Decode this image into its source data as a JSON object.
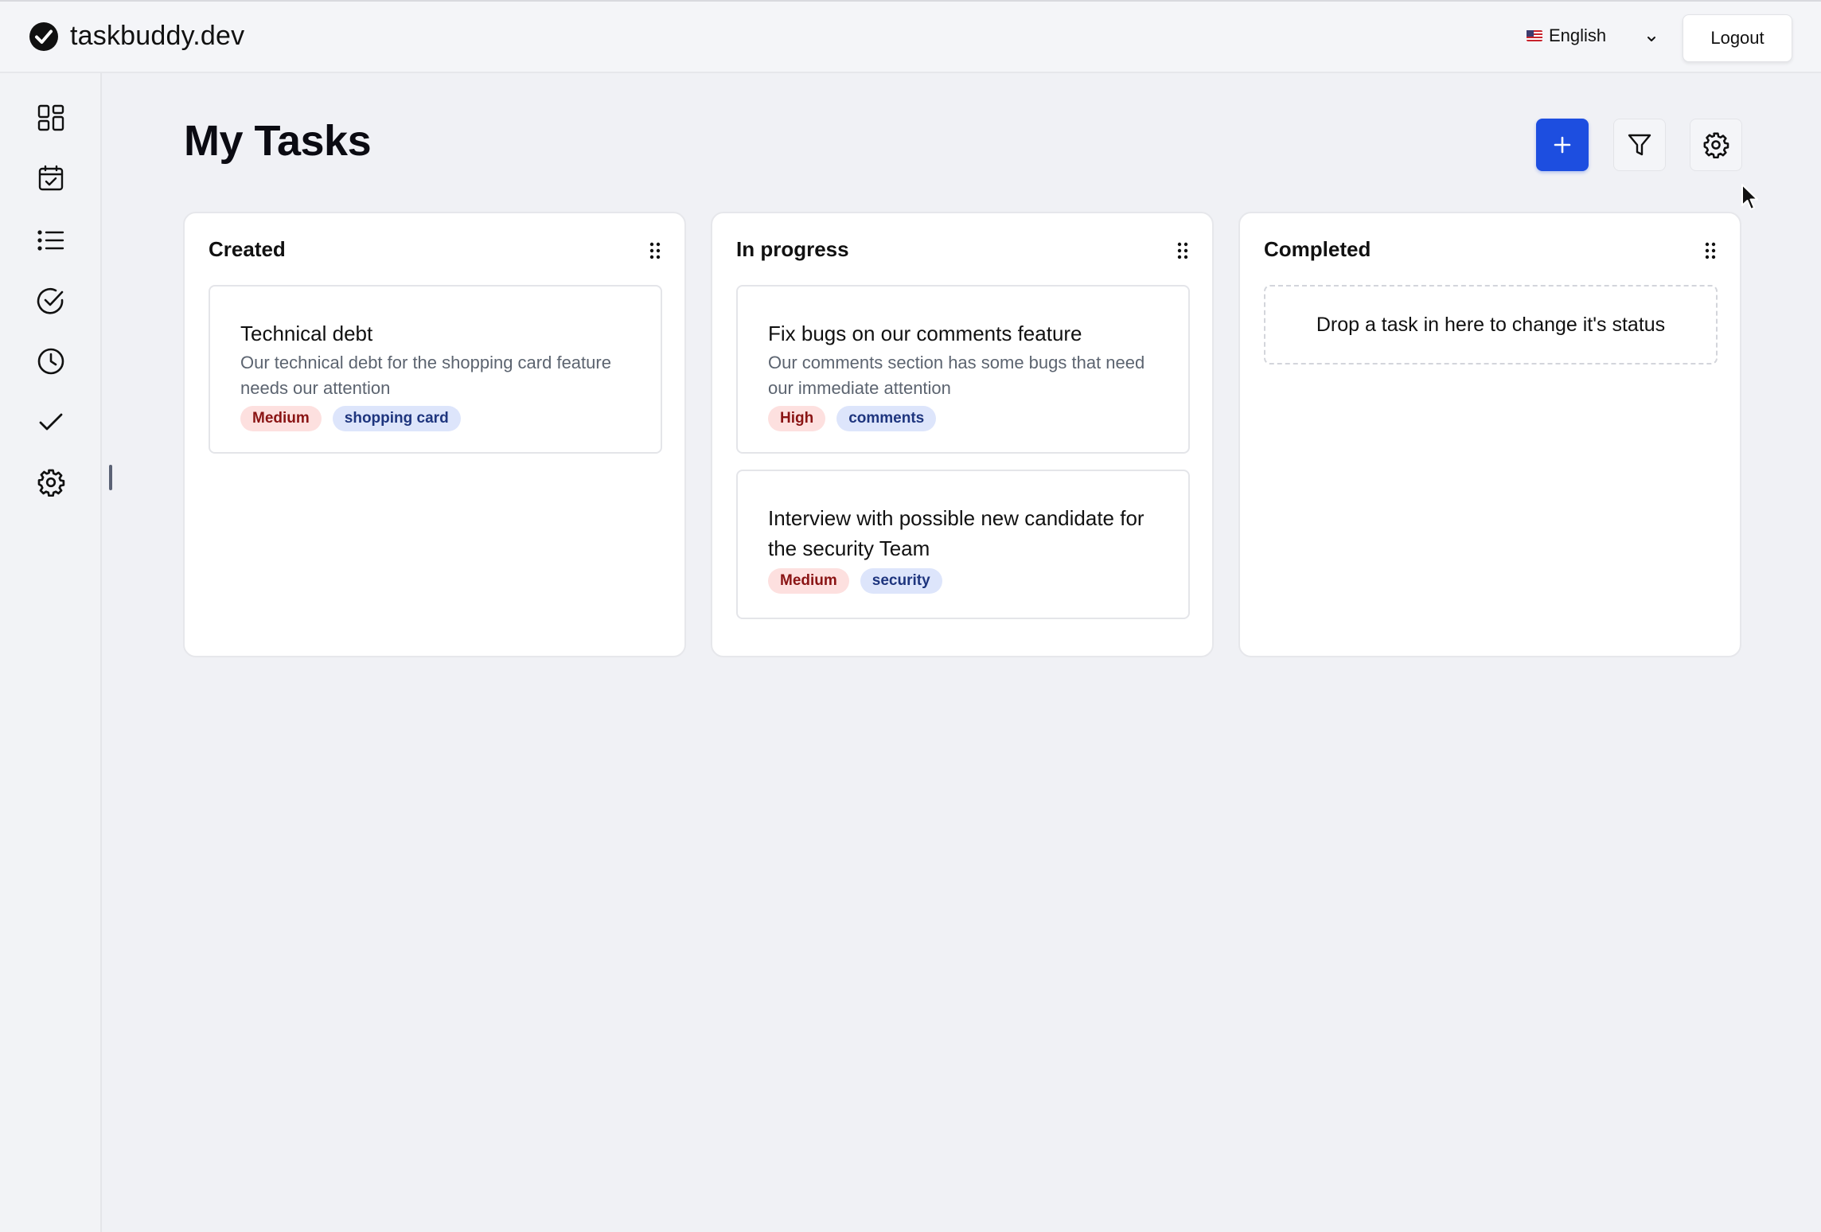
{
  "header": {
    "brand": "taskbuddy.dev",
    "language": "English",
    "logout_label": "Logout"
  },
  "sidebar": {
    "items": [
      {
        "icon": "dashboard-icon"
      },
      {
        "icon": "calendar-icon"
      },
      {
        "icon": "list-icon"
      },
      {
        "icon": "check-circle-icon"
      },
      {
        "icon": "clock-icon"
      },
      {
        "icon": "checkmark-icon"
      },
      {
        "icon": "gear-icon"
      }
    ]
  },
  "main": {
    "title": "My Tasks",
    "toolbar": {
      "add_icon": "plus-icon",
      "filter_icon": "filter-icon",
      "settings_icon": "gear-icon"
    }
  },
  "columns": [
    {
      "title": "Created",
      "cards": [
        {
          "title": "Technical debt",
          "description": "Our technical debt for the shopping card feature needs our attention",
          "tags": [
            "Medium",
            "shopping card"
          ]
        }
      ]
    },
    {
      "title": "In progress",
      "cards": [
        {
          "title": "Fix bugs on our comments feature",
          "description": "Our comments section has some bugs that need our immediate attention",
          "tags": [
            "High",
            "comments"
          ]
        },
        {
          "title": "Interview with possible new candidate for the security Team",
          "tags": [
            "Medium",
            "security"
          ]
        }
      ]
    },
    {
      "title": "Completed",
      "dropzone": "Drop a task in here to change it's status"
    }
  ],
  "colors": {
    "primary": "#1d4ee0",
    "priority_tag_bg": "#fde0df",
    "priority_tag_text": "#8a1414",
    "label_tag_bg": "#dde5fb",
    "label_tag_text": "#1e357e"
  }
}
